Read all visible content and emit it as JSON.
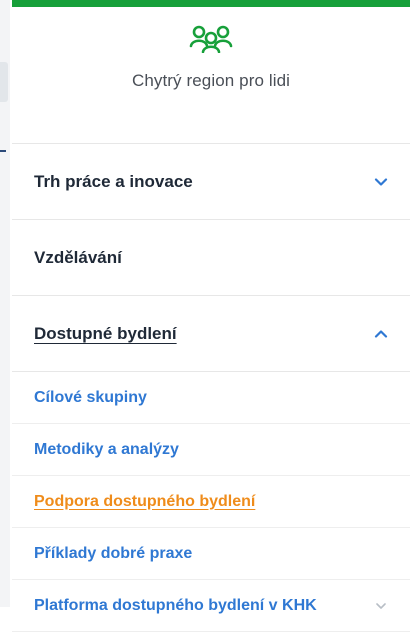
{
  "brand": {
    "logo": "three-people-icon",
    "tagline": "Chytrý region pro lidi"
  },
  "menu": [
    {
      "label": "Trh práce a inovace",
      "expanded": false,
      "chevron": "chevron-down-icon"
    },
    {
      "label": "Vzdělávání",
      "expanded": false
    },
    {
      "label": "Dostupné bydlení",
      "expanded": true,
      "chevron": "chevron-up-icon",
      "children": [
        {
          "label": "Cílové skupiny",
          "active": false
        },
        {
          "label": "Metodiky a analýzy",
          "active": false
        },
        {
          "label": "Podpora dostupného bydlení",
          "active": true
        },
        {
          "label": "Příklady dobré praxe",
          "active": false
        },
        {
          "label": "Platforma dostupného bydlení v KHK",
          "active": false,
          "chevron": "chevron-down-icon"
        }
      ]
    }
  ],
  "colors": {
    "brand_green": "#17a03a",
    "link_blue": "#2f78d3",
    "active_orange": "#ef8c1b",
    "text_dark": "#1f2937"
  }
}
